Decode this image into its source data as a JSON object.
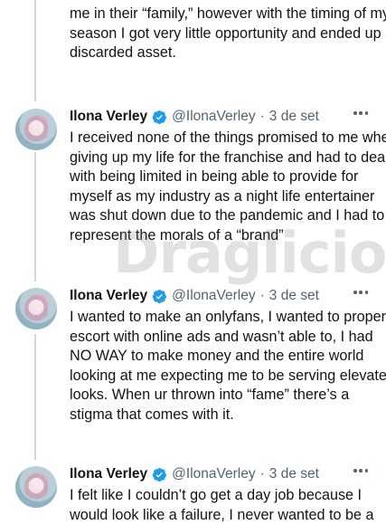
{
  "prev_tweet": {
    "lines": [
      "me in their “family,” however with the timing of my",
      "season I got very little opportunity and ended up a",
      "discarded asset."
    ]
  },
  "tweets": [
    {
      "author": "Ilona Verley",
      "handle": "@IlonaVerley",
      "separator": "·",
      "date": "3 de set",
      "lines": [
        "I received none of the things promised to me when",
        "giving up my life for the franchise and had to deal",
        "with being limited in being able to provide for",
        "myself as my industry as a night life entertainer",
        "was shut down due to the pandemic and I had to",
        "represent the morals of a “brand”"
      ]
    },
    {
      "author": "Ilona Verley",
      "handle": "@IlonaVerley",
      "separator": "·",
      "date": "3 de set",
      "lines": [
        "I wanted to make an onlyfans, I wanted to properly",
        "escort with online ads and wasn’t able to, I had",
        "NO WAY to make money and the entire world",
        "looking at me expecting me to be serving elevated",
        "looks. When ur thrown into “fame” there’s a",
        "stigma that comes with it."
      ]
    },
    {
      "author": "Ilona Verley",
      "handle": "@IlonaVerley",
      "separator": "·",
      "date": "3 de set",
      "lines": [
        "I felt like I couldn’t go get a day job because I",
        "would look like a failure, I never wanted to be a"
      ]
    }
  ],
  "watermark": "Draglicious",
  "colors": {
    "verified": "#1d9bf0",
    "muted": "#536471",
    "thread_line": "#cfd9de"
  }
}
